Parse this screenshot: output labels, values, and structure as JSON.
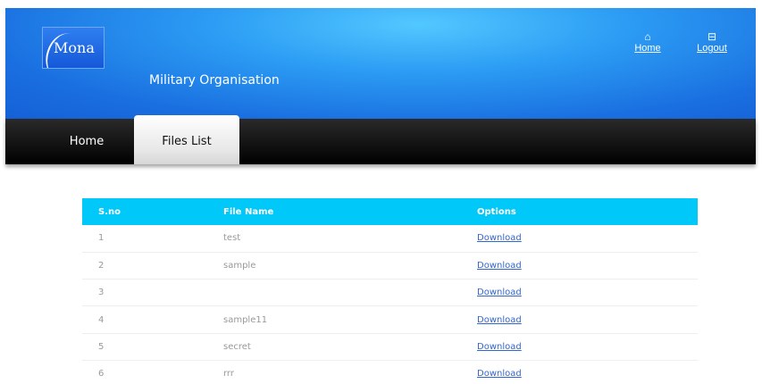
{
  "header": {
    "logo_text": "Mona",
    "org_name": "Military Organisation",
    "links": [
      {
        "label": "Home",
        "icon": "home-icon"
      },
      {
        "label": "Logout",
        "icon": "logout-icon"
      }
    ]
  },
  "nav": {
    "tabs": [
      {
        "label": "Home",
        "active": false
      },
      {
        "label": "Files List",
        "active": true
      }
    ]
  },
  "table": {
    "headers": [
      "S.no",
      "File Name",
      "Options"
    ],
    "rows": [
      {
        "sno": "1",
        "name": "test",
        "option": "Download"
      },
      {
        "sno": "2",
        "name": "sample",
        "option": "Download"
      },
      {
        "sno": "3",
        "name": "",
        "option": "Download"
      },
      {
        "sno": "4",
        "name": "sample11",
        "option": "Download"
      },
      {
        "sno": "5",
        "name": "secret",
        "option": "Download"
      },
      {
        "sno": "6",
        "name": "rrr",
        "option": "Download"
      }
    ]
  },
  "colors": {
    "header_blue": "#2c9df4",
    "table_header": "#00c8f8",
    "nav_black": "#000000",
    "link_blue": "#3366cc"
  }
}
